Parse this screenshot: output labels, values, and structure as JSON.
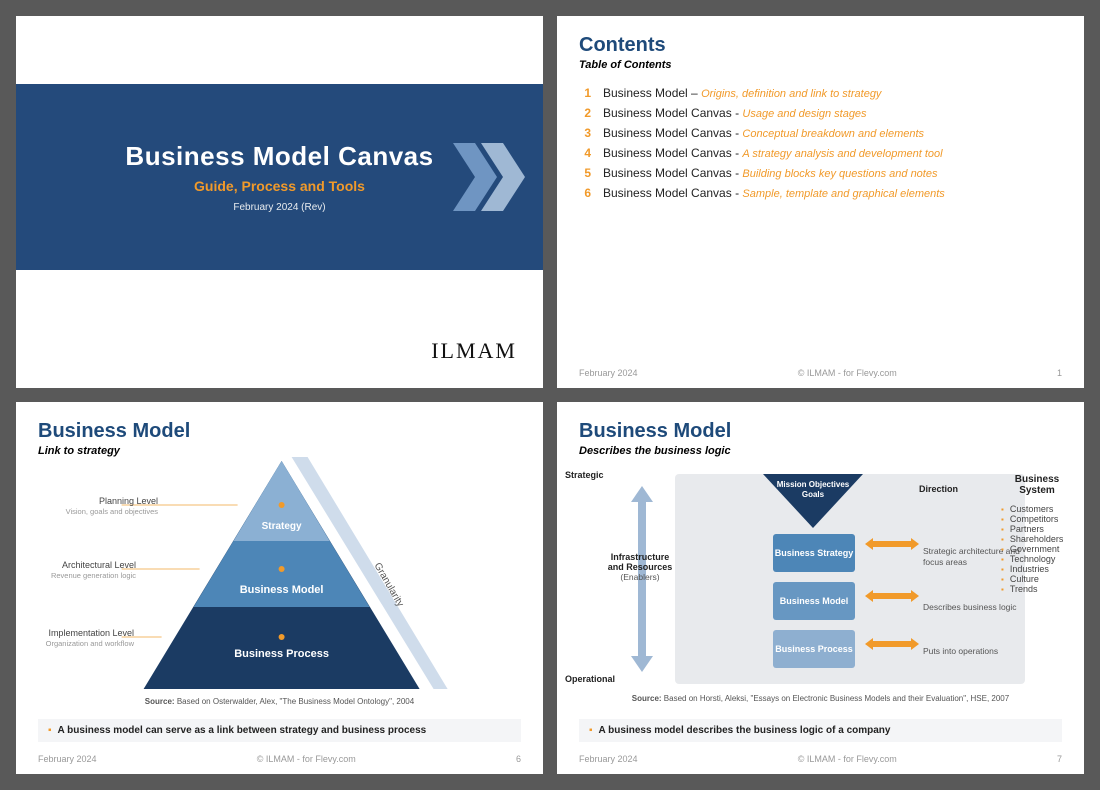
{
  "slide1": {
    "title": "Business Model Canvas",
    "subtitle": "Guide, Process and Tools",
    "date": "February 2024 (Rev)",
    "logo": "ILMAM"
  },
  "slide2": {
    "heading": "Contents",
    "sub": "Table of Contents",
    "items": [
      {
        "n": "1",
        "main": "Business Model – ",
        "tail": "Origins, definition and link to strategy"
      },
      {
        "n": "2",
        "main": "Business Model Canvas - ",
        "tail": "Usage and design stages"
      },
      {
        "n": "3",
        "main": "Business Model Canvas - ",
        "tail": "Conceptual breakdown and elements"
      },
      {
        "n": "4",
        "main": "Business Model Canvas - ",
        "tail": "A strategy analysis and development tool"
      },
      {
        "n": "5",
        "main": "Business Model Canvas - ",
        "tail": "Building blocks key questions and notes"
      },
      {
        "n": "6",
        "main": "Business Model Canvas - ",
        "tail": "Sample, template and graphical elements"
      }
    ],
    "footer_left": "February 2024",
    "footer_mid": "© ILMAM - for Flevy.com",
    "footer_right": "1"
  },
  "slide3": {
    "heading": "Business Model",
    "sub": "Link to strategy",
    "levels": [
      {
        "t": "Planning Level",
        "s": "Vision, goals and objectives",
        "band": "Strategy"
      },
      {
        "t": "Architectural Level",
        "s": "Revenue generation logic",
        "band": "Business Model"
      },
      {
        "t": "Implementation Level",
        "s": "Organization and workflow",
        "band": "Business Process"
      }
    ],
    "side": "Granularity",
    "source": "Source: Based on Osterwalder, Alex, \"The Business Model Ontology\", 2004",
    "note": "A business model can serve as a link between strategy and business process",
    "footer_left": "February 2024",
    "footer_mid": "© ILMAM - for Flevy.com",
    "footer_right": "6"
  },
  "slide4": {
    "heading": "Business Model",
    "sub": "Describes the business logic",
    "strategic": "Strategic",
    "operational": "Operational",
    "infra_t": "Infrastructure and Resources",
    "infra_s": "(Enablers)",
    "mission": "Mission Objectives Goals",
    "blk1": "Business Strategy",
    "blk2": "Business Model",
    "blk3": "Business Process",
    "dir": "Direction",
    "r1": "Strategic architecture and focus areas",
    "r2": "Describes business logic",
    "r3": "Puts into operations",
    "bs_title": "Business System",
    "bs_items": [
      "Customers",
      "Competitors",
      "Partners",
      "Shareholders",
      "Government",
      "Technology",
      "Industries",
      "Culture",
      "Trends"
    ],
    "source": "Source: Based on Horsti, Aleksi, \"Essays on Electronic Business Models and their Evaluation\", HSE, 2007",
    "note": "A business model describes the business logic of a company",
    "footer_left": "February 2024",
    "footer_mid": "© ILMAM - for Flevy.com",
    "footer_right": "7"
  }
}
